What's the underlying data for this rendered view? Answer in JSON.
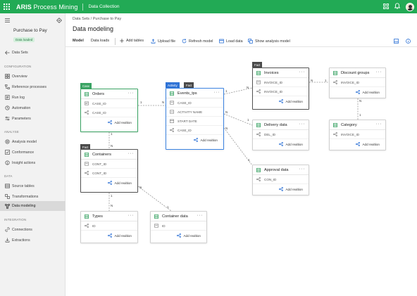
{
  "app": {
    "brand_bold": "ARIS",
    "brand_rest": " Process Mining",
    "module": "Data Collection"
  },
  "sidebar": {
    "project_title": "Purchase to Pay",
    "project_status": "Data loaded",
    "back_link": "Data Sets",
    "sections": {
      "configuration": "CONFIGURATION",
      "analyse": "ANALYSE",
      "data": "DATA",
      "integration": "INTEGRATION"
    },
    "items": [
      {
        "label": "Overview"
      },
      {
        "label": "Reference processes"
      },
      {
        "label": "Run log"
      },
      {
        "label": "Automation"
      },
      {
        "label": "Parameters"
      },
      {
        "label": "Analysis model"
      },
      {
        "label": "Conformance"
      },
      {
        "label": "Insight actions"
      },
      {
        "label": "Source tables"
      },
      {
        "label": "Transformations"
      },
      {
        "label": "Data modeling"
      },
      {
        "label": "Connections"
      },
      {
        "label": "Extractions"
      }
    ]
  },
  "breadcrumb": "Data Sets  /  Purchase to Pay",
  "page_title": "Data modeling",
  "tabs": [
    {
      "label": "Model"
    },
    {
      "label": "Data loads"
    }
  ],
  "toolbar": {
    "add_tables": "Add tables",
    "upload_file": "Upload file",
    "refresh_model": "Refresh model",
    "load_data": "Load data",
    "show_analysis_model": "Show analysis model"
  },
  "add_relation_label": "Add realtion",
  "tags": {
    "case": "Case",
    "activity": "Activity",
    "fact": "Fact"
  },
  "tables": {
    "orders": {
      "title": "Orders",
      "fields": [
        "CASE_ID",
        "CASE_ID"
      ]
    },
    "events": {
      "title": "Events_tps",
      "fields": [
        "CASE_ID",
        "ACTIVITY NAME",
        "START DATE",
        "CASE_ID"
      ]
    },
    "invoices": {
      "title": "Invoices",
      "fields": [
        "INVOICE_ID",
        "INVOICE_ID"
      ]
    },
    "discount": {
      "title": "Discount groups",
      "fields": [
        "INVOICE_ID"
      ]
    },
    "delivery": {
      "title": "Delivery data",
      "fields": [
        "DEL_ID"
      ]
    },
    "category": {
      "title": "Category",
      "fields": [
        "INVOICE_ID"
      ]
    },
    "approval": {
      "title": "Approval data",
      "fields": [
        "CON_ID"
      ]
    },
    "containers": {
      "title": "Containers",
      "fields": [
        "CONT_ID",
        "CONT_ID"
      ]
    },
    "types": {
      "title": "Types",
      "fields": [
        "ID"
      ]
    },
    "container_data": {
      "title": "Container data",
      "fields": [
        "ID"
      ]
    }
  },
  "cardinality": {
    "one": "1",
    "many": "N"
  },
  "colors": {
    "brand_green": "#22aa55",
    "case_tag": "#3aa363",
    "activity_tag": "#2f73d6",
    "fact_tag": "#4a4a4a"
  }
}
